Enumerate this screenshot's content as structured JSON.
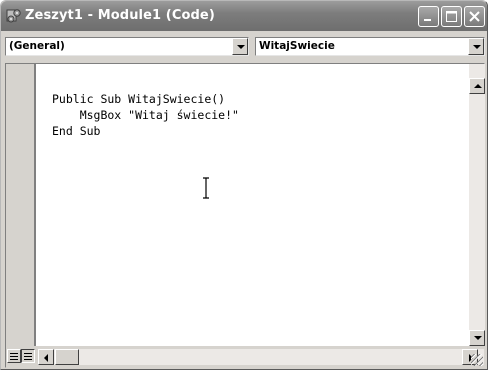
{
  "window": {
    "title": "Zeszyt1 - Module1 (Code)",
    "icon": "vba-module-icon"
  },
  "combos": {
    "object_value": "(General)",
    "procedure_value": "WitajSwiecie"
  },
  "code": {
    "lines": [
      "Public Sub WitajSwiecie()",
      "    MsgBox \"Witaj świecie!\"",
      "End Sub"
    ]
  },
  "colors": {
    "titlebar": "#7d7d7d",
    "frame": "#d6d3ce",
    "editor_bg": "#ffffff"
  }
}
